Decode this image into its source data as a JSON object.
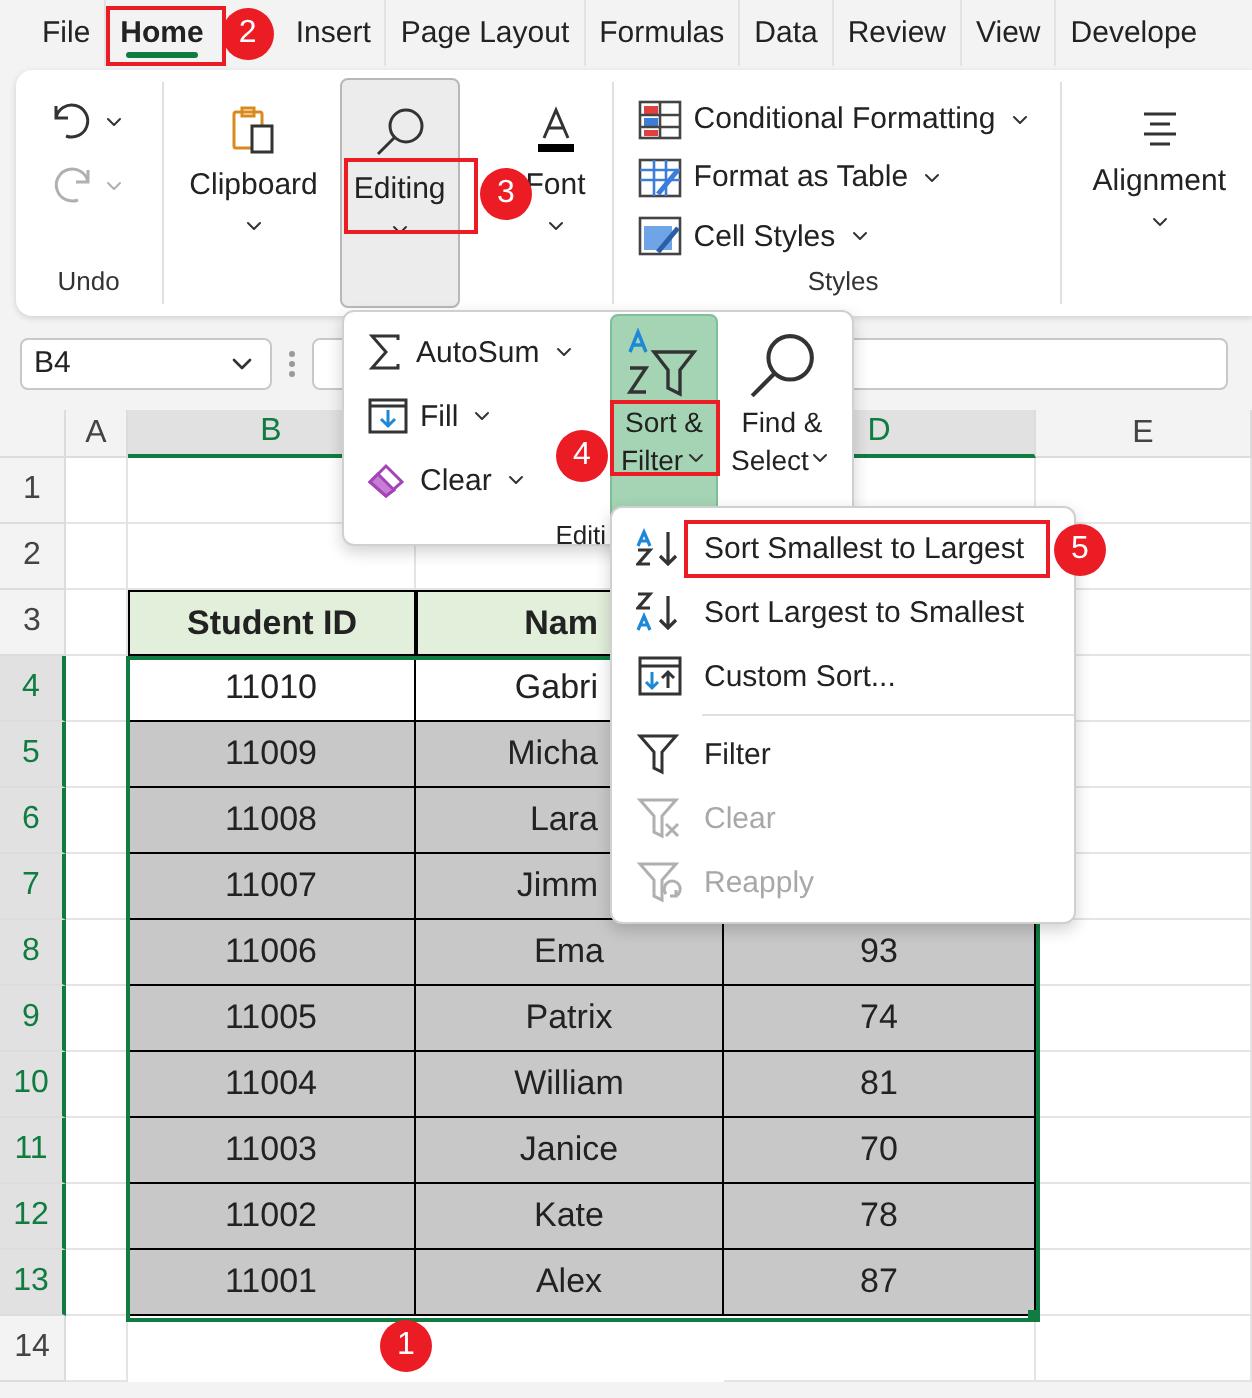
{
  "ribbon_tabs": [
    {
      "label": "File",
      "selected": false
    },
    {
      "label": "Home",
      "selected": true
    },
    {
      "label": "Insert",
      "selected": false
    },
    {
      "label": "Page Layout",
      "selected": false
    },
    {
      "label": "Formulas",
      "selected": false
    },
    {
      "label": "Data",
      "selected": false
    },
    {
      "label": "Review",
      "selected": false
    },
    {
      "label": "View",
      "selected": false
    },
    {
      "label": "Develope",
      "selected": false
    }
  ],
  "ribbon": {
    "undo_group": {
      "label": "Undo",
      "redo_disabled": true
    },
    "collapsed_groups": [
      {
        "kind": "clipboard",
        "label": "Clipboard",
        "pressed": false
      },
      {
        "kind": "editing",
        "label": "Editing",
        "pressed": true
      },
      {
        "kind": "font",
        "label": "Font",
        "pressed": false
      }
    ],
    "styles_group": {
      "label": "Styles",
      "items": [
        {
          "kind": "conditional",
          "label": "Conditional Formatting"
        },
        {
          "kind": "table",
          "label": "Format as Table"
        },
        {
          "kind": "cell",
          "label": "Cell Styles"
        }
      ]
    },
    "alignment": {
      "label": "Alignment"
    }
  },
  "name_box": "B4",
  "editing_panel": {
    "items": [
      {
        "kind": "autosum",
        "label": "AutoSum"
      },
      {
        "kind": "fill",
        "label": "Fill"
      },
      {
        "kind": "clear",
        "label": "Clear"
      }
    ],
    "sort_filter": {
      "label": "Sort & Filter",
      "selected": true
    },
    "find_select": {
      "label": "Find & Select",
      "selected": false
    },
    "group_label": "Editi"
  },
  "sort_menu": {
    "sections": [
      [
        {
          "kind": "asc",
          "label": "Sort Smallest to Largest",
          "disabled": false
        },
        {
          "kind": "desc",
          "label": "Sort Largest to Smallest",
          "disabled": false
        },
        {
          "kind": "custom",
          "label": "Custom Sort...",
          "disabled": false
        }
      ],
      [
        {
          "kind": "filter",
          "label": "Filter",
          "disabled": false
        },
        {
          "kind": "clear",
          "label": "Clear",
          "disabled": true
        },
        {
          "kind": "reapply",
          "label": "Reapply",
          "disabled": true
        }
      ]
    ]
  },
  "sheet": {
    "columns": [
      {
        "label": "A",
        "selected": false
      },
      {
        "label": "B",
        "selected": true
      },
      {
        "label": "D",
        "selected": true
      },
      {
        "label": "E",
        "selected": false
      }
    ],
    "rows": [
      {
        "label": "1",
        "selected": false
      },
      {
        "label": "2",
        "selected": false
      },
      {
        "label": "3",
        "selected": false
      },
      {
        "label": "4",
        "selected": true
      },
      {
        "label": "5",
        "selected": true
      },
      {
        "label": "6",
        "selected": true
      },
      {
        "label": "7",
        "selected": true
      },
      {
        "label": "8",
        "selected": true
      },
      {
        "label": "9",
        "selected": true
      },
      {
        "label": "10",
        "selected": true
      },
      {
        "label": "11",
        "selected": true
      },
      {
        "label": "12",
        "selected": true
      },
      {
        "label": "13",
        "selected": true
      },
      {
        "label": "14",
        "selected": false
      }
    ]
  },
  "table": {
    "header": {
      "student_id": "Student ID",
      "name": "Nam"
    },
    "rows": [
      {
        "student_id": "11010",
        "name": "Gabri",
        "active": true
      },
      {
        "student_id": "11009",
        "name": "Micha",
        "active": false
      },
      {
        "student_id": "11008",
        "name": "Lara",
        "active": false
      },
      {
        "student_id": "11007",
        "name": "Jimm",
        "active": false
      },
      {
        "student_id": "11006",
        "name": "Ema",
        "score": "93",
        "active": false
      },
      {
        "student_id": "11005",
        "name": "Patrix",
        "score": "74",
        "active": false
      },
      {
        "student_id": "11004",
        "name": "William",
        "score": "81",
        "active": false
      },
      {
        "student_id": "11003",
        "name": "Janice",
        "score": "70",
        "active": false
      },
      {
        "student_id": "11002",
        "name": "Kate",
        "score": "78",
        "active": false
      },
      {
        "student_id": "11001",
        "name": "Alex",
        "score": "87",
        "active": false
      }
    ]
  },
  "callouts": [
    "1",
    "2",
    "3",
    "4",
    "5"
  ]
}
